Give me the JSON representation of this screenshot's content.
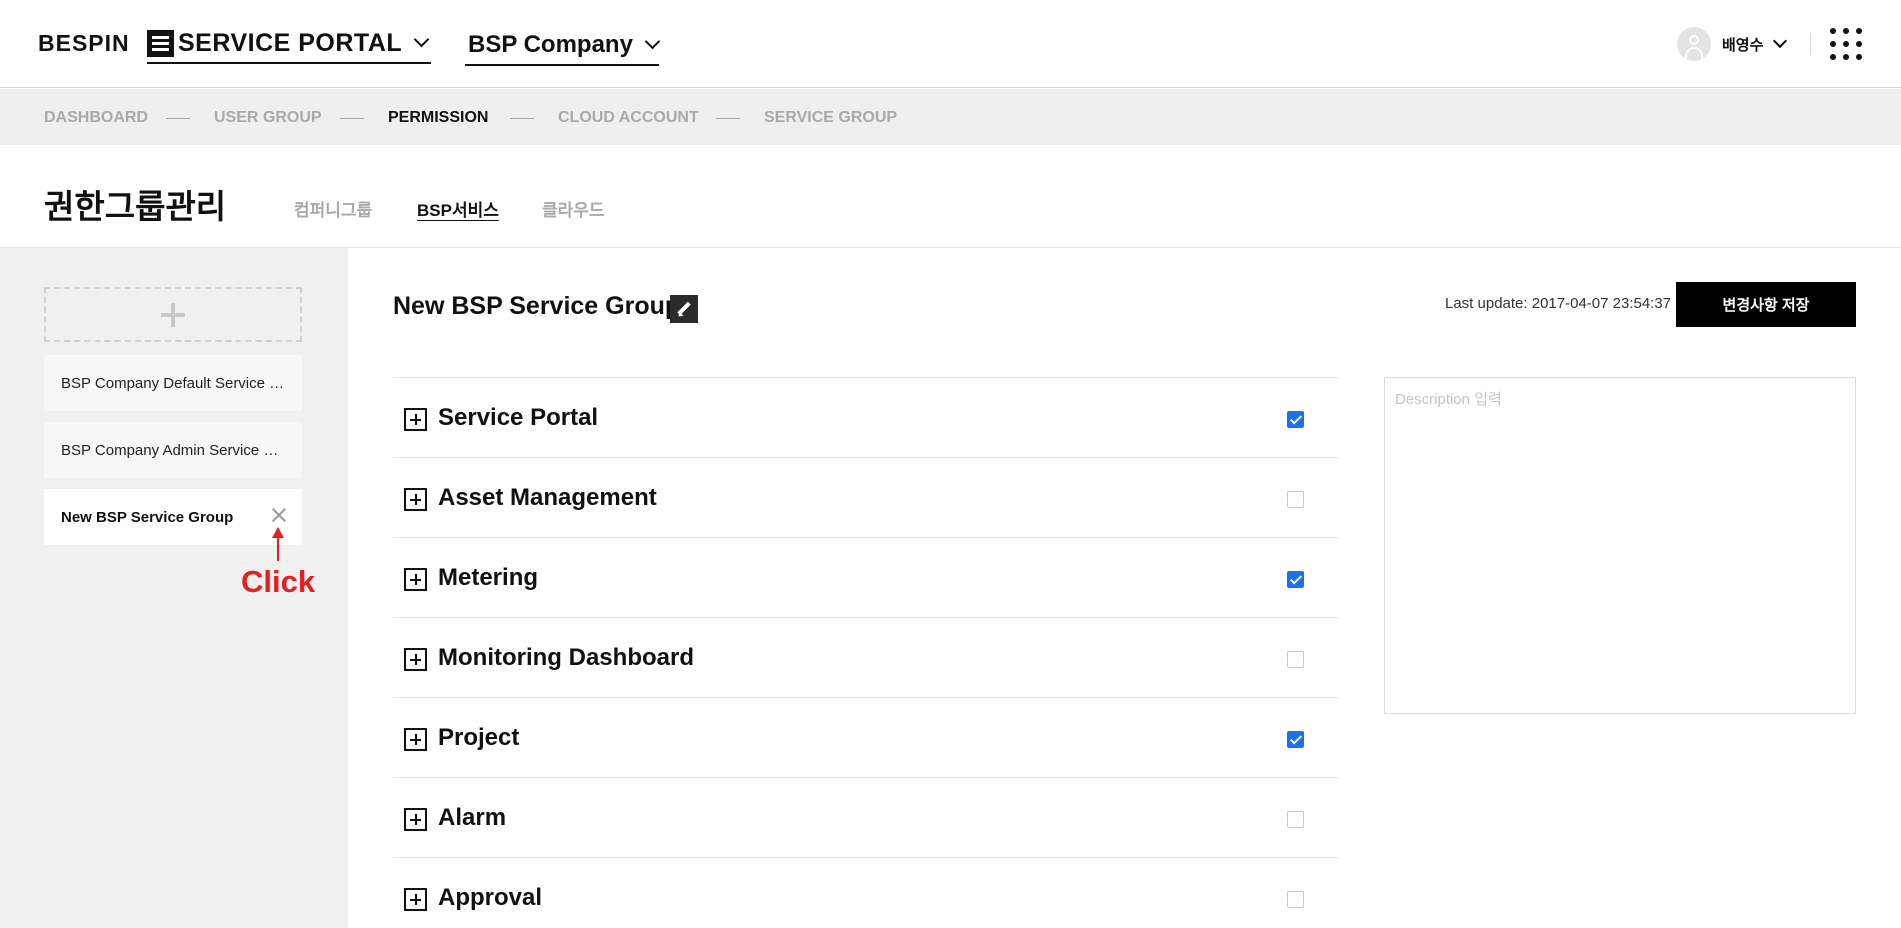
{
  "header": {
    "logo": "BESPIN",
    "portal_label": "SERVICE PORTAL",
    "company_label": "BSP Company",
    "user_name": "배영수"
  },
  "nav": {
    "items": [
      {
        "label": "DASHBOARD",
        "active": false
      },
      {
        "label": "USER GROUP",
        "active": false
      },
      {
        "label": "PERMISSION",
        "active": true
      },
      {
        "label": "CLOUD ACCOUNT",
        "active": false
      },
      {
        "label": "SERVICE GROUP",
        "active": false
      }
    ]
  },
  "page": {
    "title": "권한그룹관리",
    "tabs": [
      {
        "label": "컴퍼니그룹",
        "active": false
      },
      {
        "label": "BSP서비스",
        "active": true
      },
      {
        "label": "클라우드",
        "active": false
      }
    ]
  },
  "sidebar": {
    "groups": [
      {
        "label": "BSP Company Default Service Group",
        "active": false
      },
      {
        "label": "BSP Company Admin Service Group",
        "active": false
      },
      {
        "label": "New BSP Service Group",
        "active": true
      }
    ],
    "annotation": "Click"
  },
  "main": {
    "group_title": "New BSP Service Group",
    "last_update": "Last update: 2017-04-07 23:54:37",
    "save_label": "변경사항 저장",
    "description_placeholder": "Description 입력",
    "permissions": [
      {
        "label": "Service Portal",
        "checked": true
      },
      {
        "label": "Asset Management",
        "checked": false
      },
      {
        "label": "Metering",
        "checked": true
      },
      {
        "label": "Monitoring Dashboard",
        "checked": false
      },
      {
        "label": "Project",
        "checked": true
      },
      {
        "label": "Alarm",
        "checked": false
      },
      {
        "label": "Approval",
        "checked": false
      }
    ]
  },
  "colors": {
    "accent": "#1a73e8",
    "annotation": "#e51e1e"
  }
}
